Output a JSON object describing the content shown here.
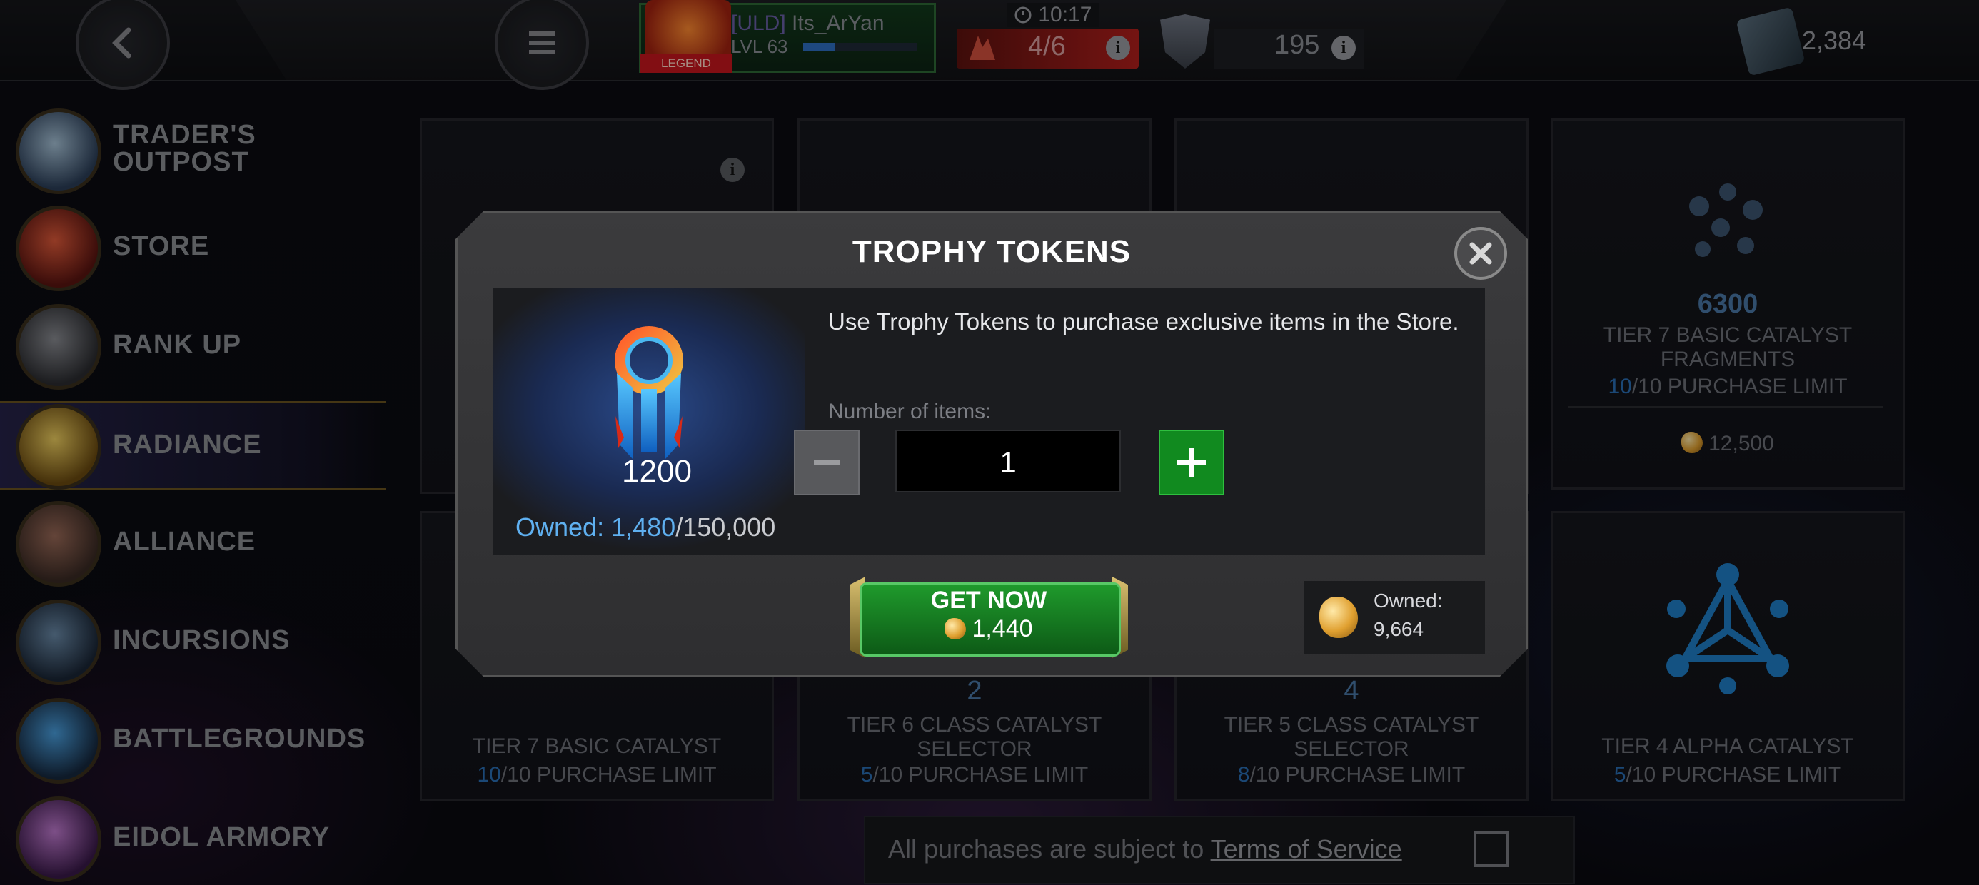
{
  "topbar": {
    "player_tag": "[ULD]",
    "player_name": "Its_ArYan",
    "player_level": "LVL 63",
    "xp_progress": 0.28,
    "legend_badge": "LEGEND",
    "timer": "10:17",
    "energy": "4/6",
    "shield_count": "195",
    "units": "2,384"
  },
  "sidebar": {
    "items": [
      {
        "label": "TRADER'S OUTPOST",
        "icon": "crystal-icon"
      },
      {
        "label": "STORE",
        "icon": "store-icon"
      },
      {
        "label": "RANK UP",
        "icon": "rank-up-icon"
      },
      {
        "label": "RADIANCE",
        "icon": "radiance-icon"
      },
      {
        "label": "ALLIANCE",
        "icon": "alliance-icon"
      },
      {
        "label": "INCURSIONS",
        "icon": "incursions-icon"
      },
      {
        "label": "BATTLEGROUNDS",
        "icon": "battlegrounds-icon"
      },
      {
        "label": "EIDOL ARMORY",
        "icon": "eidol-armory-icon"
      }
    ]
  },
  "cards": {
    "top_right": {
      "amount": "6300",
      "name": "TIER 7 BASIC CATALYST FRAGMENTS",
      "limit_current": "10",
      "limit_rest": "/10 PURCHASE LIMIT",
      "price": "12,500"
    },
    "bottom": [
      {
        "count": "",
        "name": "TIER 7 BASIC CATALYST",
        "limit_current": "10",
        "limit_rest": "/10 PURCHASE LIMIT"
      },
      {
        "count": "2",
        "name": "TIER 6 CLASS CATALYST SELECTOR",
        "limit_current": "5",
        "limit_rest": "/10 PURCHASE LIMIT"
      },
      {
        "count": "4",
        "name": "TIER 5 CLASS CATALYST SELECTOR",
        "limit_current": "8",
        "limit_rest": "/10 PURCHASE LIMIT"
      },
      {
        "count": "",
        "name": "TIER 4 ALPHA CATALYST",
        "limit_current": "5",
        "limit_rest": "/10 PURCHASE LIMIT"
      }
    ]
  },
  "dialog": {
    "title": "TROPHY TOKENS",
    "token_amount": "1200",
    "owned_label": "Owned:",
    "owned_value": "1,480",
    "owned_max": "/150,000",
    "description": "Use Trophy Tokens to purchase exclusive items in the Store.",
    "number_label": "Number of items:",
    "quantity": "1",
    "buy_label": "GET NOW",
    "buy_price": "1,440",
    "currency_owned_label": "Owned:",
    "currency_owned_value": "9,664"
  },
  "footer": {
    "text": "All purchases are subject to",
    "link": "Terms of Service"
  },
  "colors": {
    "accent_green": "#118a1f",
    "owned_blue": "#5fb0f0",
    "energy_red": "#b31f1c"
  }
}
